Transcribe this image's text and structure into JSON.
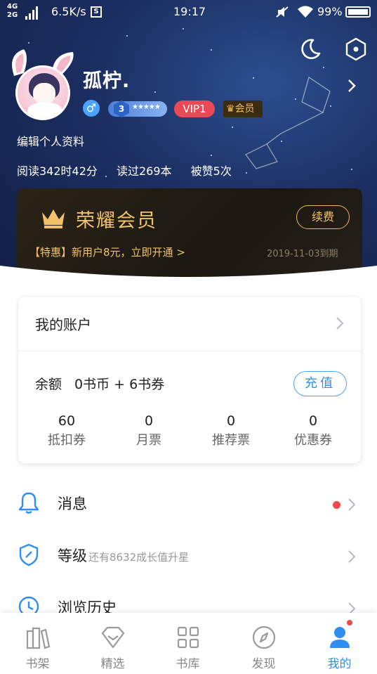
{
  "status_bar": {
    "network": "4G\n2G",
    "speed": "6.5K/s",
    "sync_icon": "S",
    "time": "19:17",
    "battery": "99%"
  },
  "header": {
    "username": "孤柠.",
    "edit_profile": "编辑个人资料",
    "level": "3",
    "level_stars": "★★★★★",
    "vip": "VIP1",
    "member_badge": "会员",
    "stats": {
      "reading_time": "阅读342时42分",
      "books_read": "读过269本",
      "likes": "被赞5次"
    }
  },
  "vip_card": {
    "title": "荣耀会员",
    "renew": "续费",
    "promo": "【特惠】新用户8元，立即开通 >",
    "expire": "2019-11-03到期"
  },
  "account": {
    "title": "我的账户",
    "balance_label": "余额",
    "balance_value": "0书币 + 6书券",
    "recharge": "充值",
    "tickets": [
      {
        "value": "60",
        "label": "抵扣券"
      },
      {
        "value": "0",
        "label": "月票"
      },
      {
        "value": "0",
        "label": "推荐票"
      },
      {
        "value": "0",
        "label": "优惠券"
      }
    ]
  },
  "menu": {
    "messages": "消息",
    "level": "等级",
    "level_hint": "还有8632成长值升星",
    "history": "浏览历史"
  },
  "nav": {
    "tabs": [
      {
        "label": "书架",
        "icon": "bookshelf-icon"
      },
      {
        "label": "精选",
        "icon": "diamond-icon"
      },
      {
        "label": "书库",
        "icon": "grid-icon"
      },
      {
        "label": "发现",
        "icon": "compass-icon"
      },
      {
        "label": "我的",
        "icon": "person-icon"
      }
    ],
    "active_index": 4
  },
  "colors": {
    "accent": "#2e8ff0",
    "gold": "#f2c26a",
    "vip_red": "#e94a55",
    "badge_red": "#f04a4a"
  }
}
